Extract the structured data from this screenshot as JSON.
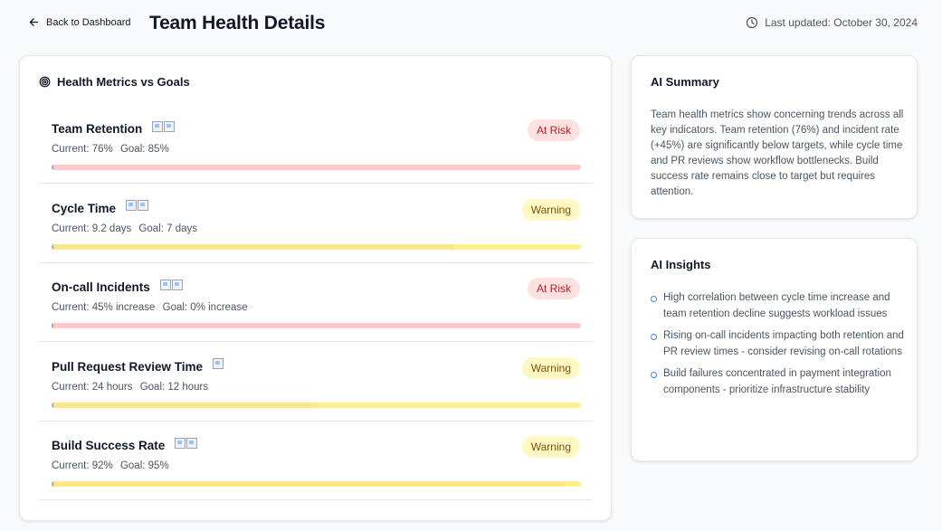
{
  "header": {
    "back_label": "Back to Dashboard",
    "title": "Team Health Details",
    "last_updated": "Last updated: October 30, 2024"
  },
  "metrics_card": {
    "title": "Health Metrics vs Goals",
    "metrics": [
      {
        "name": "Team Retention",
        "current": "Current: 76%",
        "goal": "Goal: 85%",
        "status": "At Risk",
        "status_kind": "risk",
        "progress": 0.89,
        "icon_count": 2
      },
      {
        "name": "Cycle Time",
        "current": "Current: 9.2 days",
        "goal": "Goal: 7 days",
        "status": "Warning",
        "status_kind": "warn",
        "progress": 0.76,
        "icon_count": 2
      },
      {
        "name": "On-call Incidents",
        "current": "Current: 45% increase",
        "goal": "Goal: 0% increase",
        "status": "At Risk",
        "status_kind": "risk",
        "progress": 0.0,
        "icon_count": 2
      },
      {
        "name": "Pull Request Review Time",
        "current": "Current: 24 hours",
        "goal": "Goal: 12 hours",
        "status": "Warning",
        "status_kind": "warn",
        "progress": 0.5,
        "icon_count": 1
      },
      {
        "name": "Build Success Rate",
        "current": "Current: 92%",
        "goal": "Goal: 95%",
        "status": "Warning",
        "status_kind": "warn",
        "progress": 0.97,
        "icon_count": 2
      }
    ]
  },
  "summary": {
    "title": "AI Summary",
    "text": "Team health metrics show concerning trends across all key indicators. Team retention (76%) and incident rate (+45%) are significantly below targets, while cycle time and PR reviews show workflow bottlenecks. Build success rate remains close to target but requires attention."
  },
  "insights": {
    "title": "AI Insights",
    "items": [
      "High correlation between cycle time increase and team retention decline suggests workload issues",
      "Rising on-call incidents impacting both retention and PR review times - consider revising on-call rotations",
      "Build failures concentrated in payment integration components - prioritize infrastructure stability"
    ]
  },
  "colors": {
    "risk_bg": "#fee2e2",
    "risk_text": "#b91c1c",
    "warn_bg": "#fef9c3",
    "warn_text": "#854d0e",
    "insight_dot": "#3b82f6"
  },
  "icons": {
    "back": "arrow-left-icon",
    "updated": "clock-icon",
    "metrics": "target-icon",
    "insight_bullet": "circle-bullet-icon",
    "metric_image": "broken-image-icon"
  }
}
